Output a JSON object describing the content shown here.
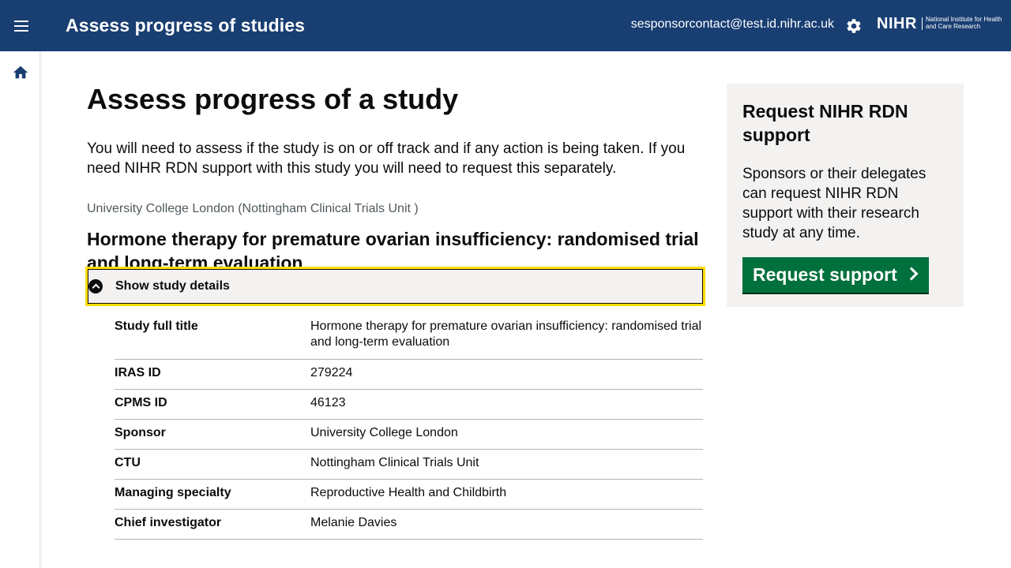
{
  "header": {
    "app_title": "Assess progress of studies",
    "user_email": "sesponsorcontact@test.id.nihr.ac.uk",
    "logo_mark": "NIHR",
    "logo_sub": "National Institute for Health and Care Research",
    "menu_icon": "menu-icon",
    "settings_icon": "gear-icon",
    "brand_color": "#193e72"
  },
  "sidebar": {
    "home_icon": "home-icon"
  },
  "main": {
    "page_title": "Assess progress of a study",
    "lead": "You will need to assess if the study is on or off track and if any action is being taken. If you need NIHR RDN support with this study you will need to request this separately.",
    "organisation": "University College London (Nottingham Clinical Trials Unit )",
    "study_title": "Hormone therapy for premature ovarian insufficiency: randomised trial and long-term evaluation",
    "details_toggle": "Show study details",
    "details": [
      {
        "key": "Study full title",
        "value": "Hormone therapy for premature ovarian insufficiency: randomised trial and long-term evaluation"
      },
      {
        "key": "IRAS ID",
        "value": "279224"
      },
      {
        "key": "CPMS ID",
        "value": "46123"
      },
      {
        "key": "Sponsor",
        "value": "University College London"
      },
      {
        "key": "CTU",
        "value": "Nottingham Clinical Trials Unit"
      },
      {
        "key": "Managing specialty",
        "value": "Reproductive Health and Childbirth"
      },
      {
        "key": "Chief investigator",
        "value": "Melanie Davies"
      }
    ]
  },
  "aside": {
    "title": "Request NIHR RDN support",
    "body": "Sponsors or their delegates can request NIHR RDN support with their research study at any time.",
    "button_label": "Request support",
    "button_color": "#00703c"
  }
}
